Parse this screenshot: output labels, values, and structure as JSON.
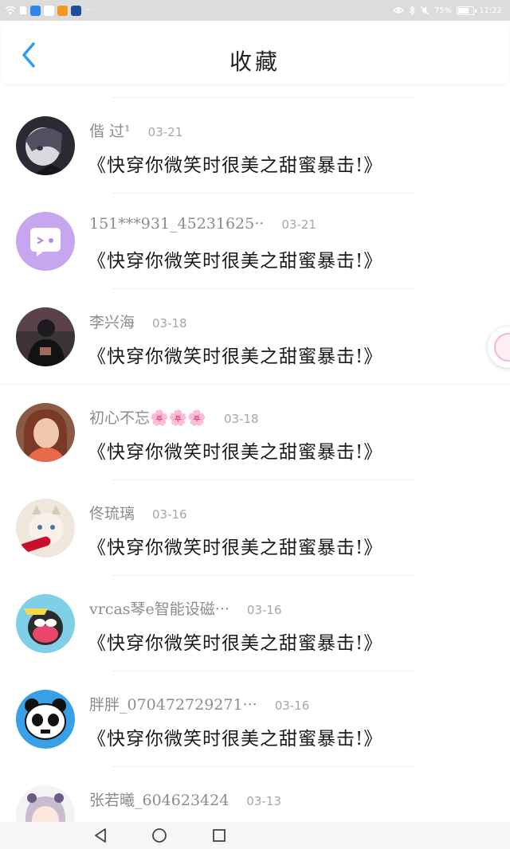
{
  "status_bar": {
    "battery": "75%",
    "time": "11:22",
    "battery_level": 0.75,
    "left_icons": [
      "wifi-icon",
      "sim-icon",
      "search-app-icon",
      "wechat-icon",
      "orange-app-icon",
      "blue-app-icon",
      "more-dots-icon"
    ],
    "right_icons": [
      "eye-icon",
      "bluetooth-icon",
      "mute-icon",
      "battery-icon"
    ]
  },
  "header": {
    "back_icon": "chevron-left-icon",
    "title": "收藏",
    "accent_color": "#2b9bf4"
  },
  "items": [
    {
      "name": "偕 过¹",
      "date": "03-21",
      "message": "《快穿你微笑时很美之甜蜜暴击!》",
      "avatar": "dark-anime-avatar"
    },
    {
      "name": "151***931_45231625··",
      "date": "03-21",
      "message": "《快穿你微笑时很美之甜蜜暴击!》",
      "avatar": "purple-chat-bubble-avatar"
    },
    {
      "name": "李兴海",
      "date": "03-18",
      "message": "《快穿你微笑时很美之甜蜜暴击!》",
      "avatar": "dark-photo-avatar"
    },
    {
      "name": "初心不忘🌸🌸🌸",
      "date": "03-18",
      "message": "《快穿你微笑时很美之甜蜜暴击!》",
      "avatar": "girl-photo-avatar"
    },
    {
      "name": "佟琉璃",
      "date": "03-16",
      "message": "《快穿你微笑时很美之甜蜜暴击!》",
      "avatar": "cat-photo-avatar"
    },
    {
      "name": "vrcas琴e智能设磁···",
      "date": "03-16",
      "message": "《快穿你微笑时很美之甜蜜暴击!》",
      "avatar": "monkey-cartoon-avatar"
    },
    {
      "name": "胖胖_070472729271···",
      "date": "03-16",
      "message": "《快穿你微笑时很美之甜蜜暴击!》",
      "avatar": "panda-pixel-avatar"
    },
    {
      "name": "张若曦_604623424",
      "date": "03-13",
      "message": "",
      "avatar": "anime-girl-avatar"
    }
  ],
  "nav": {
    "back": "triangle-back-icon",
    "home": "circle-home-icon",
    "recents": "square-recents-icon"
  },
  "side_badge": "floating-badge-icon"
}
